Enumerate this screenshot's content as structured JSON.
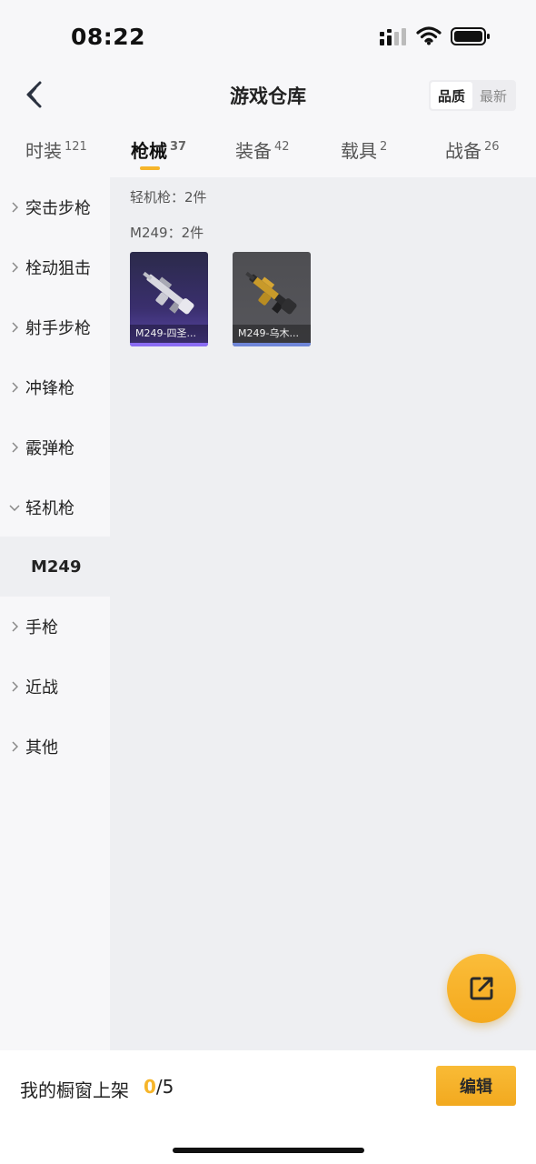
{
  "status_bar": {
    "time": "08:22"
  },
  "header": {
    "title": "游戏仓库",
    "sort_options": [
      "品质",
      "最新"
    ],
    "sort_selected": "品质"
  },
  "tabs": [
    {
      "label": "时装",
      "count": "121"
    },
    {
      "label": "枪械",
      "count": "37"
    },
    {
      "label": "装备",
      "count": "42"
    },
    {
      "label": "载具",
      "count": "2"
    },
    {
      "label": "战备",
      "count": "26"
    }
  ],
  "active_tab": "枪械",
  "sidebar": {
    "items": [
      {
        "label": "突击步枪"
      },
      {
        "label": "栓动狙击"
      },
      {
        "label": "射手步枪"
      },
      {
        "label": "冲锋枪"
      },
      {
        "label": "霰弹枪"
      },
      {
        "label": "轻机枪"
      },
      {
        "label": "手枪"
      },
      {
        "label": "近战"
      },
      {
        "label": "其他"
      }
    ],
    "expanded": "轻机枪",
    "sub_item": "M249"
  },
  "content": {
    "category_header": "轻机枪：2件",
    "weapon_header": "M249：2件",
    "items": [
      {
        "name": "M249-四圣...",
        "rarity_color": "#8a6cf2"
      },
      {
        "name": "M249-乌木...",
        "rarity_color": "#6f86d8"
      }
    ]
  },
  "bottom": {
    "shelf_label": "我的橱窗上架",
    "shelf_current": "0",
    "shelf_total": "/5",
    "edit_label": "编辑"
  },
  "colors": {
    "accent": "#f6b52a"
  }
}
